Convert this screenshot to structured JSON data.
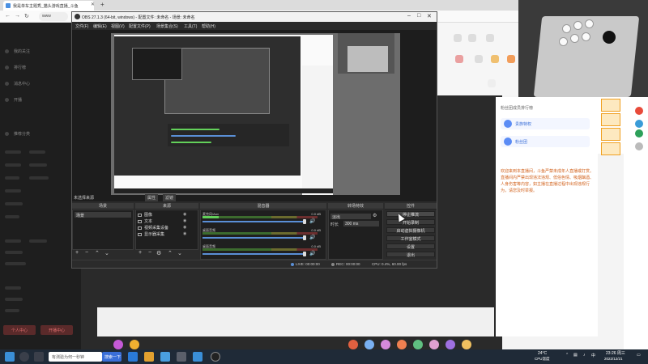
{
  "browser": {
    "tab_title": "我是单车主题秀_猫头游戏直播_斗鱼",
    "url_text": "www",
    "colors": {
      "accent": "#e8552a",
      "sidebar": "#1e1e1e"
    }
  },
  "sidebar": {
    "items": [
      "我的关注",
      "排行榜",
      "消息中心",
      "开播",
      "推荐分类"
    ],
    "buttons": [
      "个人中心",
      "开播中心"
    ]
  },
  "chat": {
    "header": "粉丝团成员排行榜",
    "cards": [
      "贵族特权",
      "粉丝团"
    ],
    "notice": "欢迎来到本直播间，斗鱼严禁未成年人直播或打赏。直播间内严禁出现违法违规、低俗色情、吸烟酗酒、人身伤害等内容，如主播在直播过程中出现违规行为，请您及时举报。"
  },
  "obs": {
    "title": "OBS 27.1.3 (64-bit, windows) - 配置文件: 未命名 - 场景: 未命名",
    "menu": [
      "文件(F)",
      "编辑(E)",
      "视图(V)",
      "配置文件(P)",
      "场景集合(S)",
      "工具(T)",
      "帮助(H)"
    ],
    "docks": {
      "scenes_header": "场景",
      "sources_header": "来源",
      "mixer_header": "混音器",
      "transitions_header": "转场特效",
      "controls_header": "控件"
    },
    "no_source": "未选择来源",
    "props_btn": "属性",
    "filters_btn": "滤镜",
    "scenes": [
      "场景"
    ],
    "sources": [
      "图像",
      "文本",
      "视频采集设备",
      "显示器采集"
    ],
    "mixer": [
      {
        "name": "麦克风/Aux",
        "db": "0.0 dB"
      },
      {
        "name": "桌面音频",
        "db": "0.0 dB"
      },
      {
        "name": "桌面音频",
        "db": "0.0 dB"
      }
    ],
    "transition": {
      "type": "淡出",
      "duration_label": "时长",
      "duration": "300 ms"
    },
    "controls": [
      "停止推流",
      "开始录制",
      "启动虚拟摄像机",
      "工作室模式",
      "设置",
      "退出"
    ],
    "status": {
      "live": "LIVE: 00:00:00",
      "rec": "REC: 00:00:00",
      "cpu": "CPU: 0.4%, 60.00 fps"
    }
  },
  "taskbar": {
    "search_text": "有测验为何一秒钟",
    "active_app": "搜索一下",
    "weather": "24°C",
    "weather_sub": "CPU温度",
    "time": "23:26 周三",
    "date": "2022/12/21"
  }
}
